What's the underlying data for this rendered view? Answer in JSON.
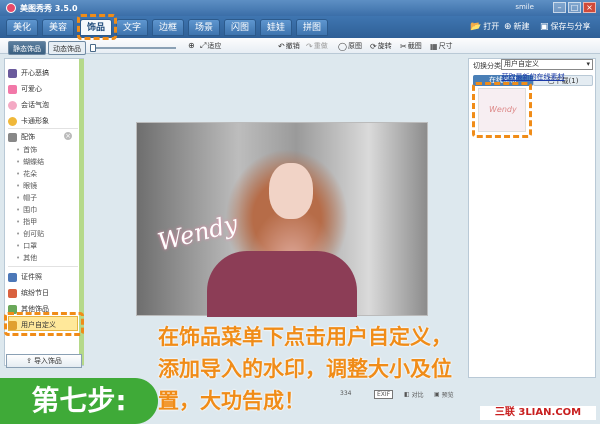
{
  "window": {
    "title": "美图秀秀 3.5.0",
    "user": "smile"
  },
  "tabs": [
    "美化",
    "美容",
    "饰品",
    "文字",
    "边框",
    "场景",
    "闪图",
    "娃娃",
    "拼图"
  ],
  "top_buttons": {
    "open": "打开",
    "new": "新建",
    "save_share": "保存与分享"
  },
  "subtabs": {
    "static": "静态饰品",
    "dynamic": "动态饰品"
  },
  "toolbar": {
    "fit": "适应",
    "undo": "撤销",
    "redo": "重做",
    "original": "原图",
    "rotate": "旋转",
    "crop": "截图",
    "size": "尺寸"
  },
  "left_panel": {
    "top_items": [
      "开心恶搞",
      "可爱心",
      "会话气泡",
      "卡通形象"
    ],
    "group": "配饰",
    "group_items": [
      "首饰",
      "蝴蝶结",
      "花朵",
      "眼镜",
      "帽子",
      "围巾",
      "指甲",
      "创可贴",
      "口罩",
      "其他"
    ],
    "bottom_items": [
      "证件照",
      "缤纷节日",
      "其他饰品",
      "用户自定义"
    ],
    "import_button": "导入饰品"
  },
  "right_panel": {
    "category_label": "切换分类",
    "category_value": "用户自定义",
    "tab_online": "在线素材",
    "tab_downloaded": "已下载(1)",
    "link": "获取最新的在线素材"
  },
  "status": {
    "size": "334",
    "exif": "EXIF",
    "compare": "对比",
    "preview": "预览"
  },
  "photo": {
    "watermark": "Wendy"
  },
  "overlay": {
    "text_lines": [
      "在饰品菜单下点击用户自定义，",
      "添加导入的水印，调整大小及位",
      "置，大功告成！"
    ],
    "step": "第七步:",
    "brand": "三联 3LIAN.COM"
  },
  "colors": {
    "accent": "#f08c18",
    "step_green": "#3faa38",
    "tab_blue": "#3f76b1"
  }
}
